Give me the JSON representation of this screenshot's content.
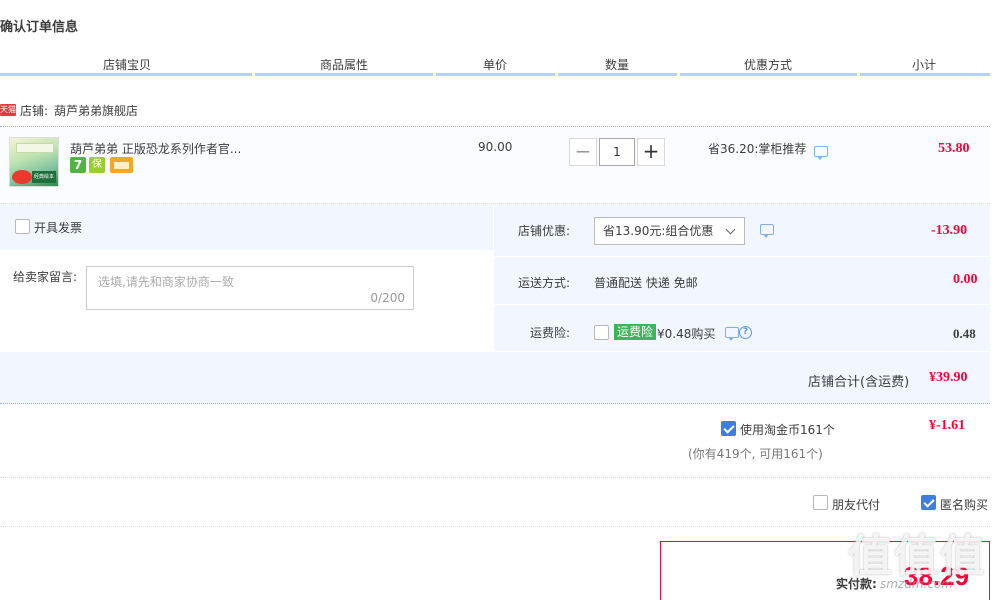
{
  "page_title": "确认订单信息",
  "columns": [
    "店铺宝贝",
    "商品属性",
    "单价",
    "数量",
    "优惠方式",
    "小计"
  ],
  "shop": {
    "badge": "天猫",
    "label": "店铺:",
    "name": "葫芦弟弟旗舰店"
  },
  "item": {
    "title": "葫芦弟弟 正版恐龙系列作者官...",
    "thumb_text": "经典绘本",
    "unit_price": "90.00",
    "quantity": "1",
    "minus_symbol": "−",
    "plus_symbol": "+",
    "discount": "省36.20:掌柜推荐",
    "subtotal": "53.80",
    "service_icons": [
      {
        "name": "seven-day-return-icon",
        "label": "7",
        "color": "#52b443"
      },
      {
        "name": "guarantee-icon",
        "label": "保",
        "color": "#9acd32"
      },
      {
        "name": "credit-card-icon",
        "label": "",
        "color": "#f5a623"
      }
    ]
  },
  "invoice": {
    "label": "开具发票",
    "checked": false
  },
  "message": {
    "label": "给卖家留言:",
    "placeholder": "选填,请先和商家协商一致",
    "counter": "0/200"
  },
  "shop_discount": {
    "label": "店铺优惠:",
    "selected": "省13.90元:组合优惠",
    "value": "-13.90"
  },
  "shipping": {
    "label": "运送方式:",
    "method": "普通配送 快递 免邮",
    "value": "0.00"
  },
  "insurance": {
    "label": "运费险:",
    "tag": "运费险",
    "text": "¥0.48购买",
    "help": "?",
    "value": "0.48"
  },
  "shop_total": {
    "label": "店铺合计(含运费)",
    "value": "¥39.90"
  },
  "coins": {
    "label": "使用淘金币161个",
    "note": "(你有419个, 可用161个)",
    "value": "¥-1.61",
    "checked": true
  },
  "options": {
    "friend_pay": "朋友代付",
    "anonymous": "匿名购买"
  },
  "payment": {
    "label": "实付款:",
    "amount": "38.29"
  },
  "watermark": {
    "main": "值值值",
    "sub": "smzdm.com"
  }
}
